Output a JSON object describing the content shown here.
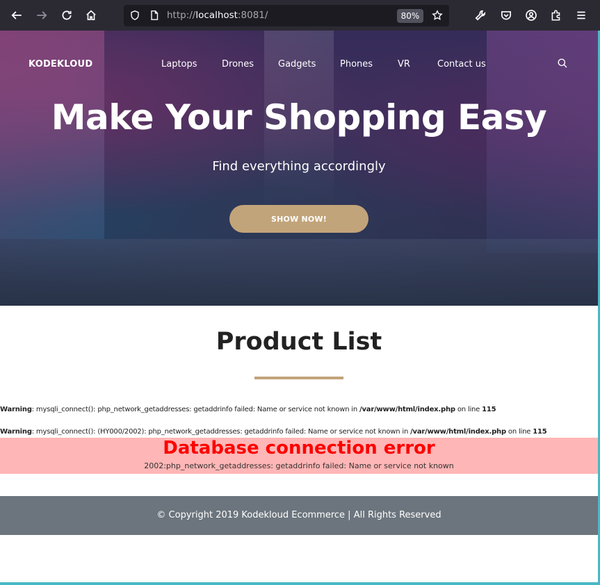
{
  "browser": {
    "url_scheme": "http://",
    "url_host": "localhost",
    "url_rest": ":8081/",
    "zoom": "80%",
    "icons": [
      "back-icon",
      "forward-icon",
      "reload-icon",
      "home-icon",
      "shield-icon",
      "page-icon",
      "bookmark-star-icon",
      "wrench-icon",
      "pocket-icon",
      "account-icon",
      "extensions-icon",
      "menu-icon"
    ]
  },
  "site": {
    "brand": "KODEKLOUD",
    "nav": [
      "Laptops",
      "Drones",
      "Gadgets",
      "Phones",
      "VR",
      "Contact us"
    ],
    "hero": {
      "title": "Make Your Shopping Easy",
      "subtitle": "Find everything accordingly",
      "button": "SHOW NOW!"
    },
    "section_title": "Product List",
    "warnings": [
      {
        "label": "Warning",
        "message": ": mysqli_connect(): php_network_getaddresses: getaddrinfo failed: Name or service not known in ",
        "file": "/var/www/html/index.php",
        "online": " on line ",
        "line": "115"
      },
      {
        "label": "Warning",
        "message": ": mysqli_connect(): (HY000/2002): php_network_getaddresses: getaddrinfo failed: Name or service not known in ",
        "file": "/var/www/html/index.php",
        "online": " on line ",
        "line": "115"
      }
    ],
    "db_error": {
      "title": "Database connection error",
      "message": "2002:php_network_getaddresses: getaddrinfo failed: Name or service not known"
    },
    "footer": "© Copyright 2019 Kodekloud Ecommerce | All Rights Reserved"
  },
  "colors": {
    "accent": "#c2a47a",
    "error_bg": "#ffb6b6",
    "error_text": "#ff0000",
    "footer_bg": "#6c757d",
    "toolbar_bg": "#2b2a33"
  }
}
